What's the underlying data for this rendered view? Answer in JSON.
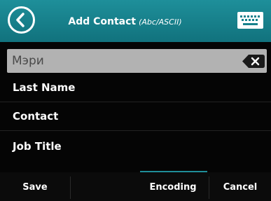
{
  "header": {
    "title": "Add Contact",
    "subtitle": "(Abc/ASCII)",
    "back_icon": "back-arrow-icon",
    "keyboard_icon": "keyboard-icon"
  },
  "name_field": {
    "value": "Мэри",
    "delete_icon": "backspace-icon"
  },
  "rows": [
    {
      "label": "Last Name"
    },
    {
      "label": "Contact"
    },
    {
      "label": "Job Title"
    }
  ],
  "softkeys": {
    "save": "Save",
    "encoding": "Encoding",
    "cancel": "Cancel",
    "active_color": "#1f8e99"
  },
  "colors": {
    "header": "#17818c",
    "background": "#050505",
    "field": "#b2b2b2"
  }
}
